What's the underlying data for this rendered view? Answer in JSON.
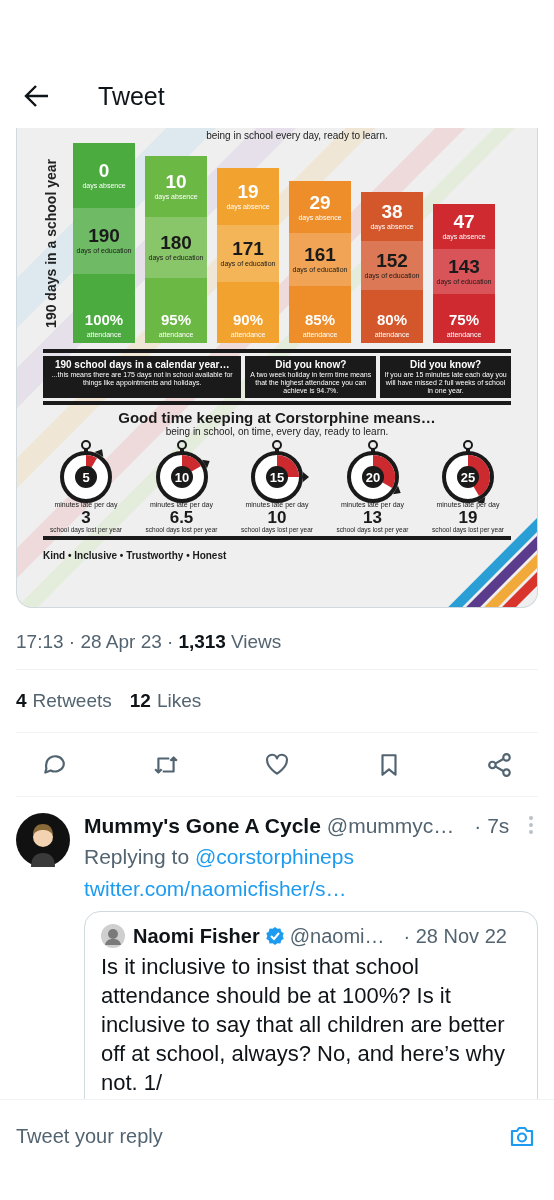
{
  "header": {
    "title": "Tweet"
  },
  "infographic": {
    "top_line": "being in school every day, ready to learn.",
    "side_label": "190 days in a school year",
    "columns": [
      {
        "absence": "0",
        "absence_label": "days absence",
        "education": "190",
        "education_label": "days of education",
        "attendance": "100%",
        "attendance_label": "attendance",
        "color": "#4bab3f"
      },
      {
        "absence": "10",
        "absence_label": "days absence",
        "education": "180",
        "education_label": "days of education",
        "attendance": "95%",
        "attendance_label": "attendance",
        "color": "#6cb845"
      },
      {
        "absence": "19",
        "absence_label": "days absence",
        "education": "171",
        "education_label": "days of education",
        "attendance": "90%",
        "attendance_label": "attendance",
        "color": "#f2a22f"
      },
      {
        "absence": "29",
        "absence_label": "days absence",
        "education": "161",
        "education_label": "days of education",
        "attendance": "85%",
        "attendance_label": "attendance",
        "color": "#ee8e2b"
      },
      {
        "absence": "38",
        "absence_label": "days absence",
        "education": "152",
        "education_label": "days of education",
        "attendance": "80%",
        "attendance_label": "attendance",
        "color": "#d4572b"
      },
      {
        "absence": "47",
        "absence_label": "days absence",
        "education": "143",
        "education_label": "days of education",
        "attendance": "75%",
        "attendance_label": "attendance",
        "color": "#cf2a30"
      }
    ],
    "facts": [
      {
        "title": "190 school days in a calendar year…",
        "text": "...this means there are 175 days not in school available for things like appointments and holidays."
      },
      {
        "title": "Did you know?",
        "text": "A two week holiday in term time means that the highest attendance you can achieve is 94.7%."
      },
      {
        "title": "Did you know?",
        "text": "If you are 15 minutes late each day you will have missed 2 full weeks of school in one year."
      }
    ],
    "heading": "Good time keeping at Corstorphine means…",
    "subheading": "being in school, on time, every day, ready to learn.",
    "timers": [
      {
        "minutes": "5",
        "ring_text": "minutes late per day",
        "days": "3",
        "days_label": "school days lost per year"
      },
      {
        "minutes": "10",
        "ring_text": "minutes late per day",
        "days": "6.5",
        "days_label": "school days lost per year"
      },
      {
        "minutes": "15",
        "ring_text": "minutes late per day",
        "days": "10",
        "days_label": "school days lost per year"
      },
      {
        "minutes": "20",
        "ring_text": "minutes late per day",
        "days": "13",
        "days_label": "school days lost per year"
      },
      {
        "minutes": "25",
        "ring_text": "minutes late per day",
        "days": "19",
        "days_label": "school days lost per year"
      }
    ],
    "values_line": "Kind • Inclusive • Trustworthy • Honest"
  },
  "meta": {
    "time": "17:13 · 28 Apr 23 ·",
    "views_count": "1,313",
    "views_label": "Views"
  },
  "stats": [
    {
      "count": "4",
      "label": "Retweets"
    },
    {
      "count": "12",
      "label": "Likes"
    }
  ],
  "actions": [
    {
      "kind": "reply"
    },
    {
      "kind": "retweet"
    },
    {
      "kind": "like"
    },
    {
      "kind": "bookmark"
    },
    {
      "kind": "share"
    }
  ],
  "reply": {
    "name": "Mummy's Gone A Cycle",
    "handle": "@mummyc…",
    "time": "· 7s",
    "replying_prefix": "Replying to",
    "replying_handle": "@corstorphineps",
    "link": "twitter.com/naomicfisher/s…",
    "quote": {
      "name": "Naomi Fisher",
      "verified": true,
      "handle": "@naomi…",
      "time": "· 28 Nov 22",
      "text": "Is it inclusive to insist that school attendance should be at 100%? Is it inclusive to say that all children are better off at school, always? No, and here’s why not. 1/"
    }
  },
  "compose": {
    "placeholder": "Tweet your reply"
  }
}
